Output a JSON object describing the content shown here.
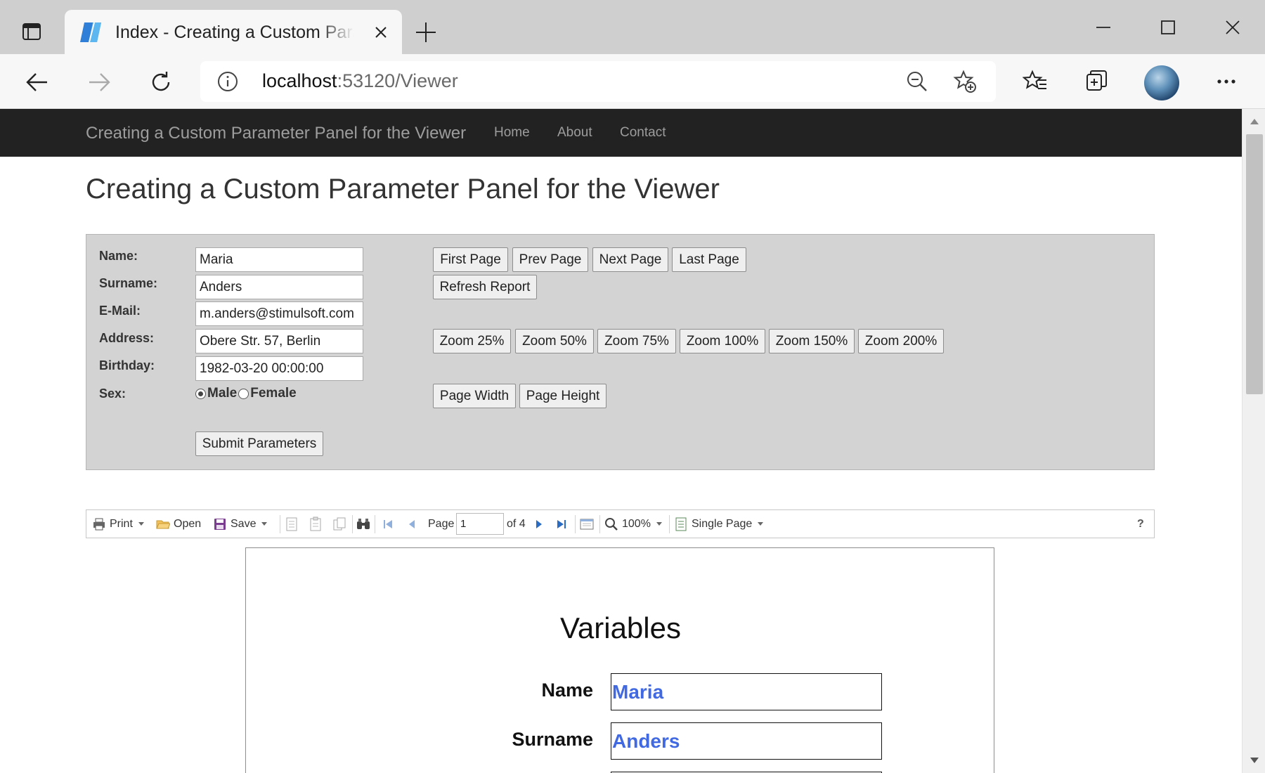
{
  "browser": {
    "tab_title": "Index - Creating a Custom Param",
    "url_host": "localhost",
    "url_path": ":53120/Viewer"
  },
  "icons": {
    "tab_actions": "tab-actions-icon",
    "favicon": "page-favicon",
    "close_tab": "close-icon",
    "new_tab": "plus-icon",
    "minimize": "minimize-icon",
    "maximize": "maximize-icon",
    "close_window": "close-icon",
    "back": "back-arrow-icon",
    "forward": "forward-arrow-icon",
    "refresh": "refresh-icon",
    "site_info": "info-icon",
    "zoom_out": "zoom-out-icon",
    "add_favorite": "star-add-icon",
    "favorites": "favorites-icon",
    "collections": "collections-icon",
    "menu": "more-icon"
  },
  "navbar": {
    "brand": "Creating a Custom Parameter Panel for the Viewer",
    "links": [
      "Home",
      "About",
      "Contact"
    ]
  },
  "page": {
    "heading": "Creating a Custom Parameter Panel for the Viewer"
  },
  "params": {
    "labels": {
      "name": "Name:",
      "surname": "Surname:",
      "email": "E-Mail:",
      "address": "Address:",
      "birthday": "Birthday:",
      "sex": "Sex:"
    },
    "values": {
      "name": "Maria",
      "surname": "Anders",
      "email": "m.anders@stimulsoft.com",
      "address": "Obere Str. 57, Berlin",
      "birthday": "1982-03-20 00:00:00"
    },
    "sex_options": [
      "Male",
      "Female"
    ],
    "sex_selected": "Male",
    "submit": "Submit Parameters",
    "nav_buttons": [
      "First Page",
      "Prev Page",
      "Next Page",
      "Last Page"
    ],
    "refresh": "Refresh Report",
    "zoom_buttons": [
      "Zoom 25%",
      "Zoom 50%",
      "Zoom 75%",
      "Zoom 100%",
      "Zoom 150%",
      "Zoom 200%"
    ],
    "fit_buttons": [
      "Page Width",
      "Page Height"
    ]
  },
  "viewer_toolbar": {
    "print": "Print",
    "open": "Open",
    "save": "Save",
    "page_label": "Page",
    "page_value": "1",
    "of_pages": "of 4",
    "zoom": "100%",
    "view_mode": "Single Page",
    "help": "?"
  },
  "report": {
    "title": "Variables",
    "rows": [
      {
        "label": "Name",
        "value": "Maria"
      },
      {
        "label": "Surname",
        "value": "Anders"
      }
    ]
  },
  "colors": {
    "navbar_bg": "#222222",
    "panel_bg": "#d3d3d3",
    "report_value": "#4169e1"
  }
}
